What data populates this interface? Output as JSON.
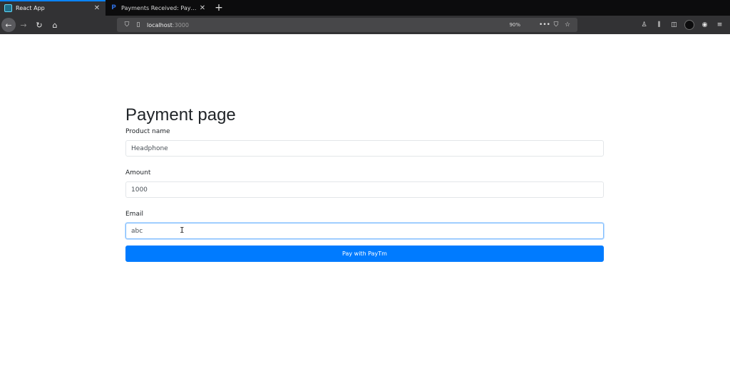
{
  "browser": {
    "tabs": [
      {
        "title": "React App",
        "active": true,
        "favicon": "react-icon"
      },
      {
        "title": "Payments Received: Paytm for Business",
        "active": false,
        "favicon": "paytm-icon"
      }
    ],
    "new_tab_label": "+",
    "url": {
      "host": "localhost",
      "port": ":3000"
    },
    "zoom": "90%"
  },
  "page": {
    "title": "Payment page",
    "fields": {
      "product": {
        "label": "Product name",
        "value": "Headphone"
      },
      "amount": {
        "label": "Amount",
        "value": "1000"
      },
      "email": {
        "label": "Email",
        "value": "abc"
      }
    },
    "pay_button": "Pay with PayTm"
  },
  "colors": {
    "primary": "#007bff",
    "focus_border": "#80bdff",
    "chrome_dark": "#0c0c0d"
  }
}
